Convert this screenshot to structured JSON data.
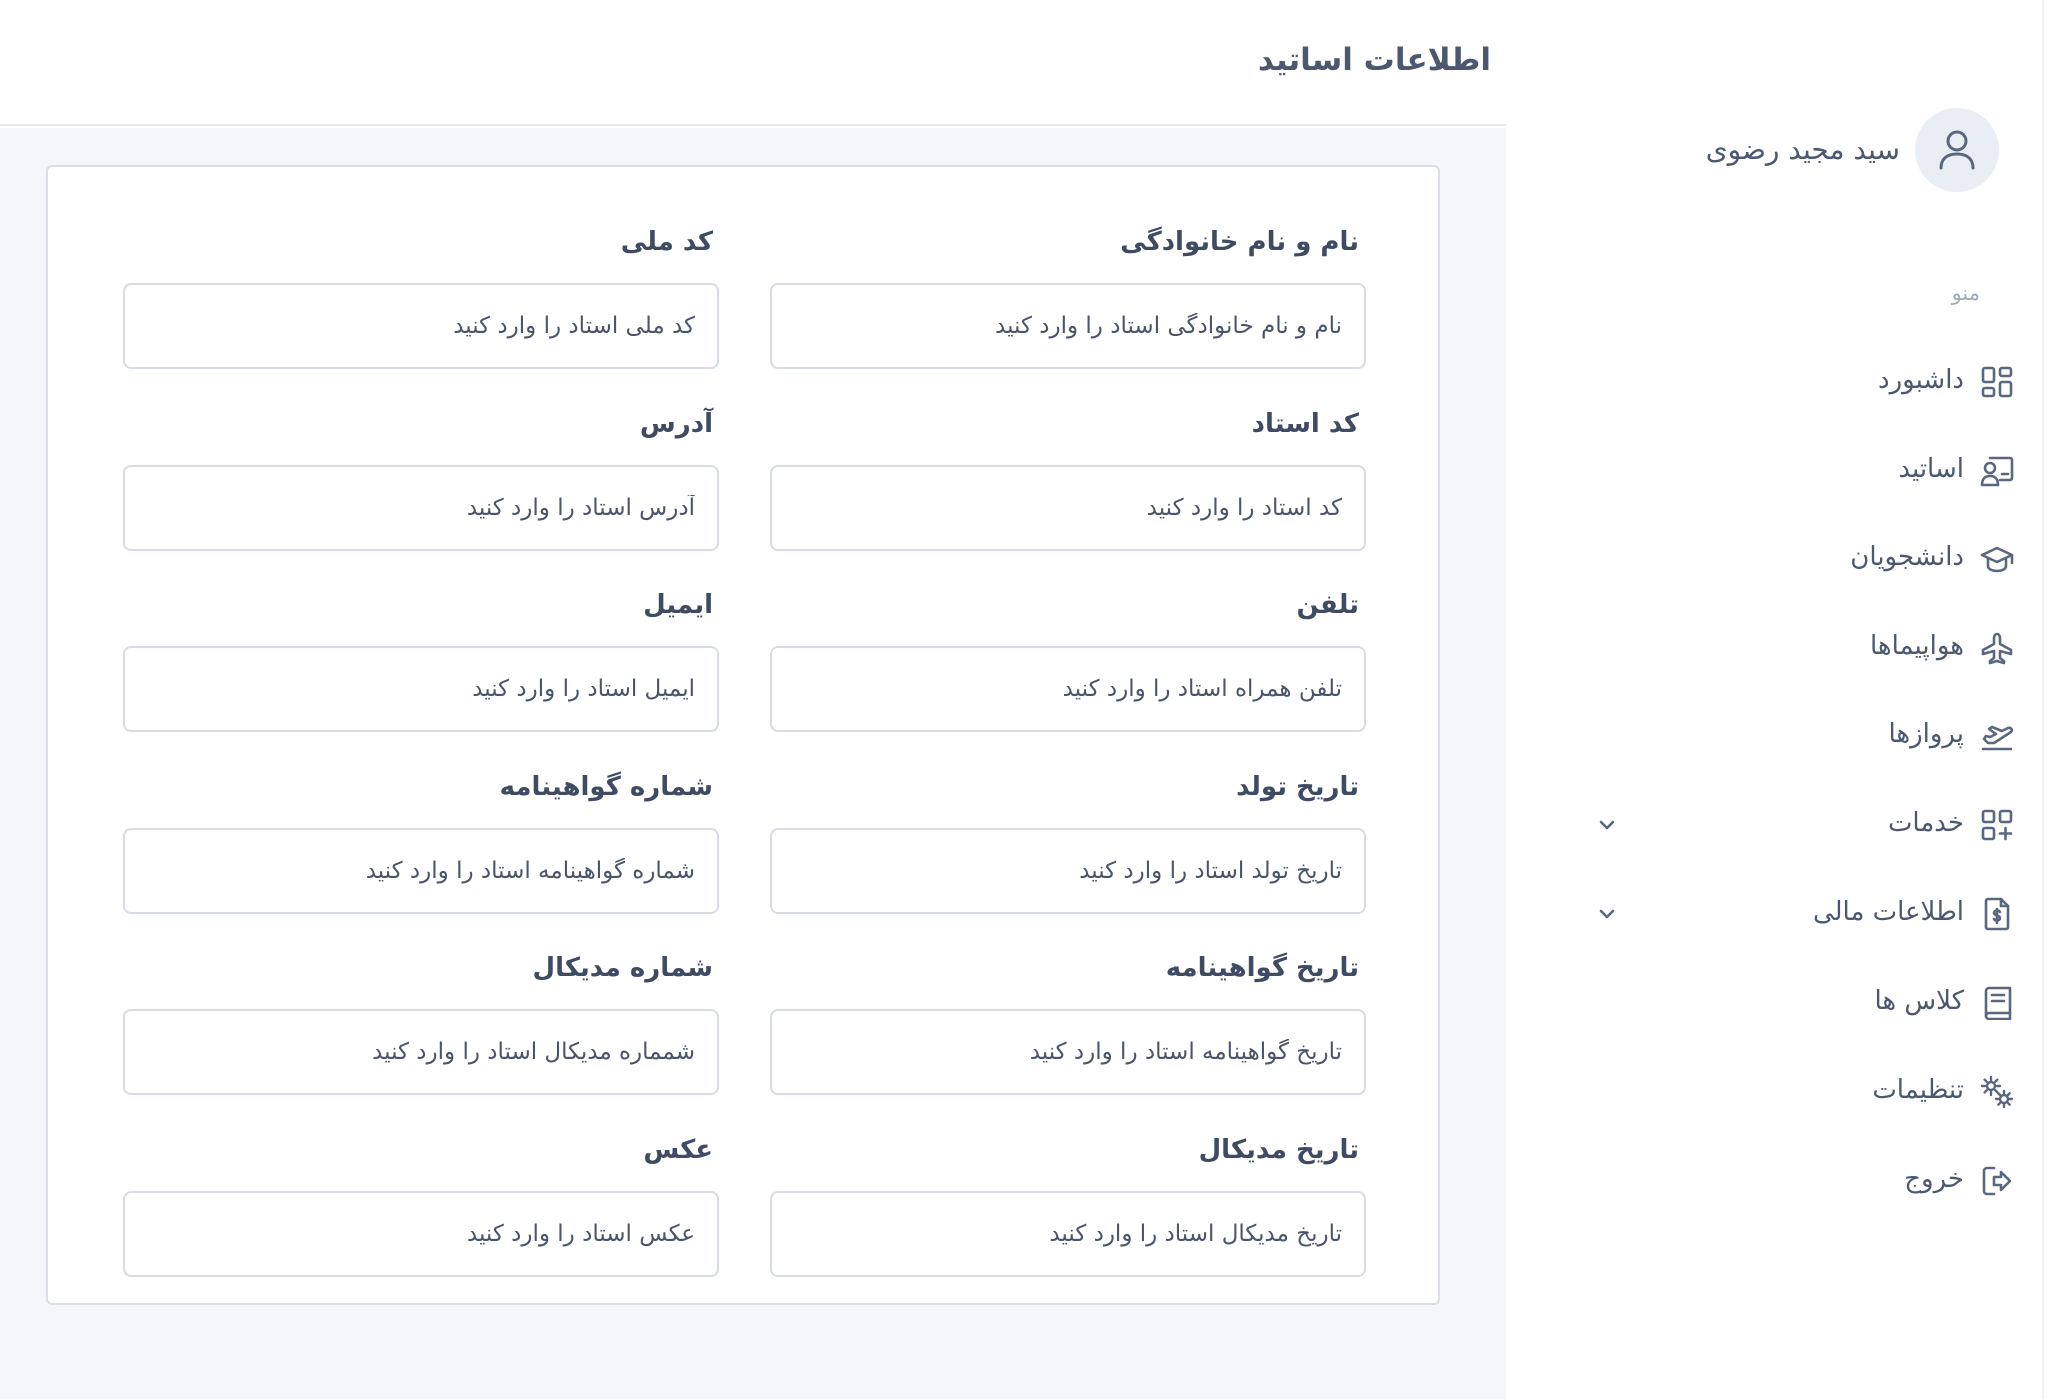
{
  "header": {
    "title": "اطلاعات اساتید"
  },
  "form": {
    "full_name": {
      "label": "نام و نام خانوادگی",
      "placeholder": "نام و نام خانوادگی استاد را وارد کنید",
      "value": ""
    },
    "national_code": {
      "label": "کد ملی",
      "placeholder": "کد ملی استاد را وارد کنید",
      "value": ""
    },
    "teacher_code": {
      "label": "کد استاد",
      "placeholder": "کد استاد را وارد کنید",
      "value": ""
    },
    "address": {
      "label": "آدرس",
      "placeholder": "آدرس استاد را وارد کنید",
      "value": ""
    },
    "phone": {
      "label": "تلفن",
      "placeholder": "تلفن همراه استاد را وارد کنید",
      "value": ""
    },
    "email": {
      "label": "ایمیل",
      "placeholder": "ایمیل استاد را وارد کنید",
      "value": ""
    },
    "birth_date": {
      "label": "تاریخ تولد",
      "placeholder": "تاریخ تولد استاد را وارد کنید",
      "value": ""
    },
    "license_number": {
      "label": "شماره گواهینامه",
      "placeholder": "شماره گواهینامه استاد را وارد کنید",
      "value": ""
    },
    "license_date": {
      "label": "تاریخ گواهینامه",
      "placeholder": "تاریخ گواهینامه استاد را وارد کنید",
      "value": ""
    },
    "medical_number": {
      "label": "شماره مدیکال",
      "placeholder": "شمماره مدیکال استاد را وارد کنید",
      "value": ""
    },
    "medical_date": {
      "label": "تاریخ مدیکال",
      "placeholder": "تاریخ مدیکال استاد را وارد کنید",
      "value": ""
    },
    "photo": {
      "label": "عکس",
      "placeholder": "عکس استاد را وارد کنید",
      "value": ""
    }
  },
  "sidebar": {
    "user_name": "سید مجید رضوی",
    "avatar_icon": "user-icon",
    "menu_heading": "منو",
    "items": [
      {
        "label": "داشبورد",
        "icon": "dashboard-icon"
      },
      {
        "label": "اساتید",
        "icon": "teacher-icon"
      },
      {
        "label": "دانشجویان",
        "icon": "graduation-cap-icon"
      },
      {
        "label": "هواپیماها",
        "icon": "airplane-icon"
      },
      {
        "label": "پروازها",
        "icon": "takeoff-icon"
      },
      {
        "label": "خدمات",
        "icon": "add-grid-icon",
        "expandable": true
      },
      {
        "label": "اطلاعات مالی",
        "icon": "invoice-icon",
        "expandable": true
      },
      {
        "label": "کلاس ها",
        "icon": "book-icon"
      },
      {
        "label": "تنظیمات",
        "icon": "settings-icon"
      },
      {
        "label": "خروج",
        "icon": "logout-icon"
      }
    ]
  },
  "colors": {
    "text": "#3f4b63",
    "content_background": "#f4f6fa",
    "border": "#d7dce5",
    "muted": "#a2abba",
    "avatar_background": "#e9edf4"
  }
}
